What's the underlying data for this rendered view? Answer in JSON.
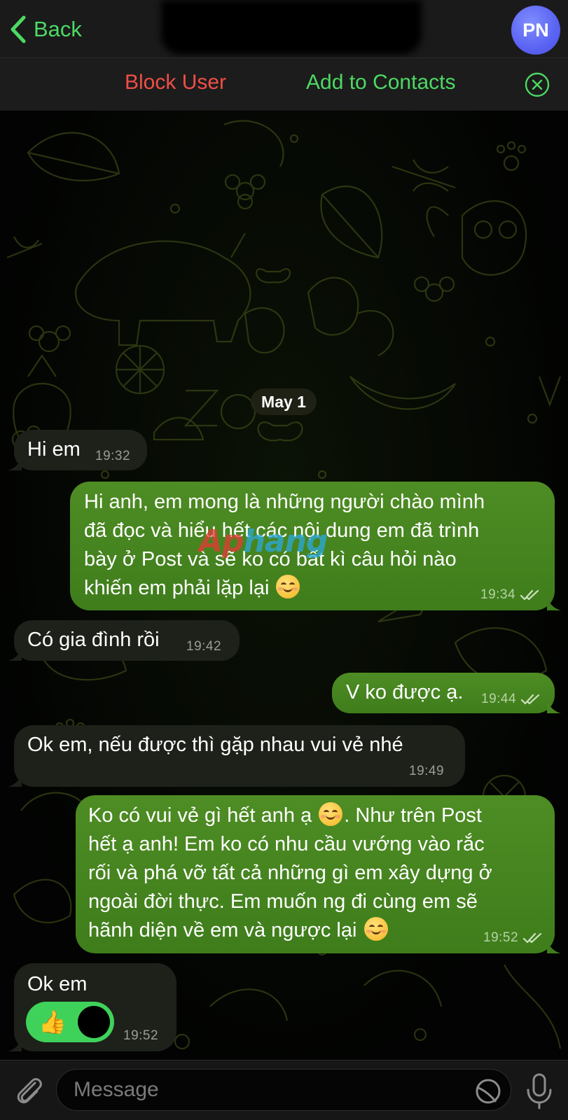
{
  "header": {
    "back_label": "Back",
    "avatar_initials": "PN"
  },
  "actions": {
    "block_user": "Block User",
    "add_to_contacts": "Add to Contacts"
  },
  "date_separator": "May 1",
  "messages": [
    {
      "direction": "incoming",
      "text": "Hi em",
      "time": "19:32"
    },
    {
      "direction": "outgoing",
      "lines": [
        "Hi anh, em mong là những người chào mình",
        "đã đọc và hiểu hết các nội dung em đã trình",
        "bày ở Post và sẽ ko có bất kì câu hỏi nào",
        "khiến em phải lặp lại"
      ],
      "emoji": "smiling-face-icon",
      "time": "19:34",
      "status": "read"
    },
    {
      "direction": "incoming",
      "text": "Có gia đình rồi",
      "time": "19:42"
    },
    {
      "direction": "outgoing",
      "text": "V ko được ạ.",
      "time": "19:44",
      "status": "read"
    },
    {
      "direction": "incoming",
      "text": "Ok em, nếu được thì gặp nhau vui vẻ nhé",
      "time": "19:49"
    },
    {
      "direction": "outgoing",
      "lines": [
        "Ko có vui vẻ gì hết anh ạ",
        ". Như trên Post",
        "hết ạ anh! Em ko có nhu cầu vướng vào rắc",
        "rối và phá vỡ tất cả những gì em xây dựng ở",
        "ngoài đời thực. Em muốn ng đi cùng em sẽ",
        "hãnh diện về em và ngược lại"
      ],
      "emoji": "smiling-face-icon",
      "time": "19:52",
      "status": "read"
    },
    {
      "direction": "incoming",
      "text": "Ok em",
      "time": "19:52",
      "reaction": {
        "emoji": "👍",
        "icon": "thumbs-up-icon"
      }
    }
  ],
  "watermark": {
    "part1": "Ap",
    "part2": "hang"
  },
  "composer": {
    "placeholder": "Message"
  },
  "colors": {
    "accent_green": "#4cd964",
    "block_red": "#f04e47",
    "outgoing_bubble": "#46851f",
    "incoming_bubble": "#1d211a",
    "avatar": "#5a63f2",
    "reaction": "#3fd25b"
  }
}
